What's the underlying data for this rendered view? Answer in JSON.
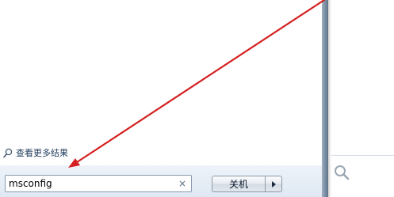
{
  "start_menu": {
    "see_more_results": {
      "icon": "search-icon",
      "label": "查看更多结果"
    },
    "search": {
      "value": "msconfig",
      "clear_icon": "close-icon",
      "clear_glyph": "×"
    },
    "shutdown": {
      "label": "关机",
      "arrow_icon": "triangle-right-icon"
    }
  },
  "annotation": {
    "type": "arrow",
    "color": "#d42020",
    "points_to": "search-input"
  },
  "colors": {
    "frame": "#7f93a8",
    "bottom_strip": "#e6edf6",
    "link_text": "#1e395b"
  }
}
